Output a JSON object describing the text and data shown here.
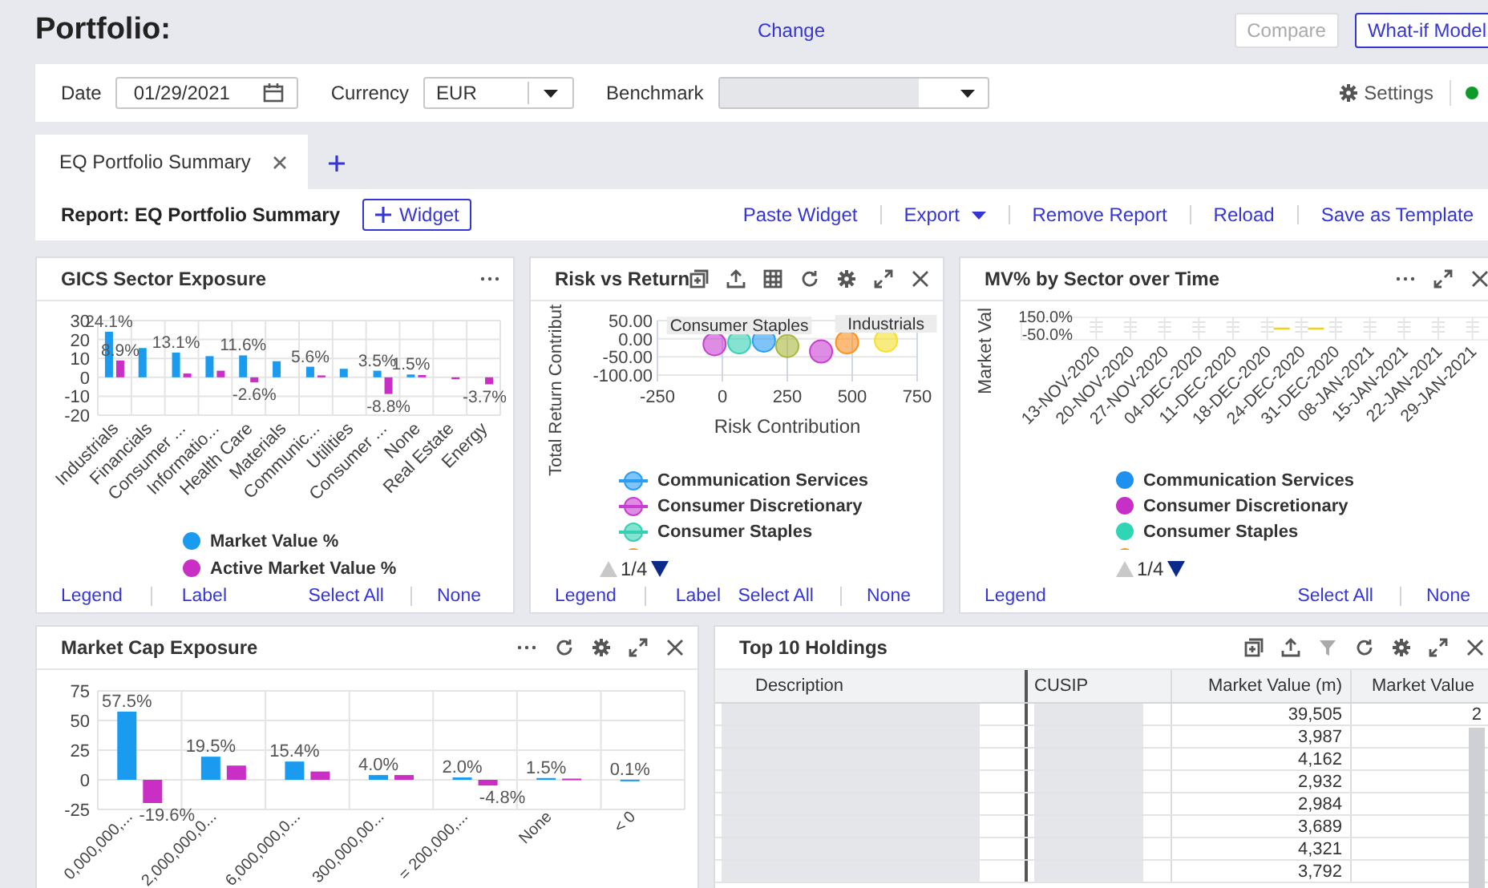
{
  "header": {
    "title": "Portfolio:",
    "change_link": "Change",
    "buttons": [
      {
        "label": "Compare",
        "disabled": true
      },
      {
        "label": "What-if Model",
        "disabled": false
      }
    ]
  },
  "toolbar": {
    "date": {
      "label": "Date",
      "value": "01/29/2021"
    },
    "currency": {
      "label": "Currency",
      "value": "EUR"
    },
    "benchmark": {
      "label": "Benchmark"
    },
    "settings": "Settings"
  },
  "tabs": [
    {
      "label": "EQ Portfolio Summary",
      "selected": true
    }
  ],
  "report": {
    "title": "Report: EQ Portfolio Summary",
    "add_widget": "Widget",
    "actions": [
      {
        "label": "Paste Widget",
        "kind": "link"
      },
      {
        "label": "Export",
        "kind": "menu"
      },
      {
        "label": "Remove Report",
        "kind": "link"
      },
      {
        "label": "Reload",
        "kind": "link"
      },
      {
        "label": "Save as Template",
        "kind": "link"
      }
    ]
  },
  "widgets": [
    {
      "kind": "chart",
      "title": "GICS Sector Exposure",
      "chart_data": {
        "type": "bar",
        "grid": true,
        "categories": [
          "Industrials",
          "Financials",
          "Consumer ...",
          "Informatio...",
          "Health Care",
          "Materials",
          "Communic...",
          "Utilities",
          "Consumer ...",
          "None",
          "Real Estate",
          "Energy"
        ],
        "ylim": [
          -20,
          30
        ],
        "yticks": [
          30,
          20,
          10,
          0,
          -10,
          -20
        ],
        "series": [
          {
            "name": "Market Value %",
            "color": "#1a9bf0",
            "values": [
              24.1,
              15.5,
              13.1,
              11.2,
              11.6,
              8.5,
              5.6,
              4.5,
              3.5,
              1.5,
              0,
              0
            ]
          },
          {
            "name": "Active Market Value %",
            "color": "#c92fc4",
            "values": [
              8.9,
              0,
              2,
              3.5,
              -2.6,
              0,
              1,
              0,
              -8.8,
              1.2,
              -1,
              -3.7
            ]
          }
        ],
        "value_labels": [
          [
            "24.1%",
            null,
            "13.1%",
            null,
            "11.6%",
            null,
            "5.6%",
            null,
            "3.5%",
            "1.5%",
            null,
            null
          ],
          [
            "8.9%",
            null,
            null,
            null,
            "-2.6%",
            null,
            null,
            null,
            "-8.8%",
            null,
            null,
            "-3.7%"
          ]
        ]
      },
      "footer": {
        "left": [
          "Legend",
          "Label"
        ],
        "right": [
          "Select All",
          "None"
        ]
      }
    },
    {
      "kind": "chart",
      "title": "Risk vs Return",
      "chart_data": {
        "type": "scatter",
        "grid": true,
        "xlabel": "Risk Contribution",
        "ylabel": "Total Return Contribut",
        "xlim": [
          -250,
          750
        ],
        "ylim": [
          -100,
          50
        ],
        "xticks": [
          -250,
          0,
          250,
          500,
          750
        ],
        "yticks": [
          {
            "value": 50,
            "label": "50.00"
          },
          {
            "value": 0,
            "label": "0.00"
          },
          {
            "value": -50,
            "label": "-50.00"
          },
          {
            "value": -100,
            "label": "-100.00"
          }
        ],
        "series": [
          {
            "color": "#2a9df4",
            "x": [
              160
            ],
            "values": [
              -5
            ]
          },
          {
            "color": "#c93fd2",
            "x": [
              -30,
              380
            ],
            "values": [
              -15,
              -35
            ]
          },
          {
            "color": "#33d1b2",
            "x": [
              65
            ],
            "values": [
              -10
            ]
          },
          {
            "color": "#ff8f1f",
            "x": [
              480
            ],
            "values": [
              -10
            ]
          },
          {
            "color": "#a9b83c",
            "x": [
              250
            ],
            "values": [
              -20
            ]
          },
          {
            "color": "#f5e02a",
            "x": [
              630
            ],
            "values": [
              -5
            ]
          }
        ],
        "annotations": [
          {
            "text": "Consumer Staples",
            "x": 65,
            "y": -10
          },
          {
            "text": "Industrials",
            "x": 630,
            "y": -5
          }
        ]
      },
      "legend": [
        {
          "name": "Communication Services",
          "color": "#2a9df4"
        },
        {
          "name": "Consumer Discretionary",
          "color": "#c93fd2"
        },
        {
          "name": "Consumer Staples",
          "color": "#33d1b2"
        },
        {
          "color": "#ff8f1f"
        }
      ],
      "legend_page": "1/4",
      "footer": {
        "left": [
          "Legend",
          "Label"
        ],
        "right": [
          "Select All",
          "None"
        ]
      }
    },
    {
      "kind": "timeline",
      "title": "MV% by Sector over Time",
      "axis": {
        "ylabel": "Market Val",
        "ytick_labels": [
          "150.0%",
          "-50.0%"
        ],
        "xtick_labels": [
          "13-NOV-2020",
          "20-NOV-2020",
          "27-NOV-2020",
          "04-DEC-2020",
          "11-DEC-2020",
          "18-DEC-2020",
          "24-DEC-2020",
          "31-DEC-2020",
          "08-JAN-2021",
          "15-JAN-2021",
          "22-JAN-2021",
          "29-JAN-2021"
        ]
      },
      "legend": [
        {
          "name": "Communication Services",
          "color": "#1e90f0"
        },
        {
          "name": "Consumer Discretionary",
          "color": "#c62fc8"
        },
        {
          "name": "Consumer Staples",
          "color": "#2fd6b4"
        },
        {
          "color": "#ff8f1f"
        }
      ],
      "legend_page": "1/4",
      "footer": {
        "left": [
          "Legend"
        ],
        "right": [
          "Select All",
          "None"
        ]
      }
    },
    {
      "kind": "chart",
      "title": "Market Cap Exposure",
      "chart_data": {
        "type": "bar",
        "grid": true,
        "categories": [
          "0,000,000,...",
          "2,000,000,0...",
          "6,000,000,0...",
          "300,000,00...",
          "= 200,000,...",
          "None",
          "< 0"
        ],
        "ylim": [
          -25,
          75
        ],
        "yticks": [
          75,
          50,
          25,
          0,
          -25
        ],
        "series": [
          {
            "color": "#1a9bf0",
            "values": [
              57.5,
              19.5,
              15.4,
              4.0,
              2.0,
              1.5,
              0.1
            ]
          },
          {
            "color": "#c92fc4",
            "values": [
              -19.6,
              12,
              7,
              4,
              -4.8,
              1,
              0
            ]
          }
        ],
        "value_labels": [
          [
            "57.5%",
            "19.5%",
            "15.4%",
            "4.0%",
            "2.0%",
            "1.5%",
            "0.1%"
          ],
          [
            "-19.6%",
            null,
            null,
            null,
            "-4.8%",
            null,
            null
          ]
        ]
      }
    },
    {
      "kind": "table",
      "title": "Top 10 Holdings",
      "columns": [
        "Description",
        "CUSIP",
        "Market Value (m)",
        "Market Value"
      ],
      "rows": [
        {
          "market_value_m": "39,505",
          "column_4": "2"
        },
        {
          "market_value_m": "3,987"
        },
        {
          "market_value_m": "4,162"
        },
        {
          "market_value_m": "2,932"
        },
        {
          "market_value_m": "2,984"
        },
        {
          "market_value_m": "3,689"
        },
        {
          "market_value_m": "4,321"
        },
        {
          "market_value_m": "3,792"
        }
      ]
    }
  ]
}
